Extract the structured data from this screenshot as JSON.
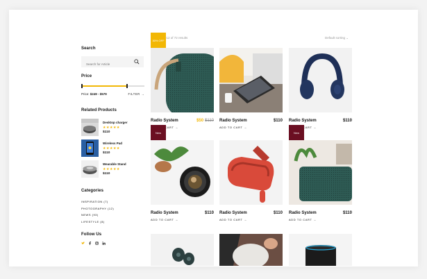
{
  "sidebar": {
    "search_title": "Search",
    "search_placeholder": "Search for Article",
    "price_title": "Price",
    "price_label": "Price:",
    "price_range": "$249 - $579",
    "price_fraction": 0.72,
    "filter_label": "FILTER",
    "related_title": "Related Products",
    "related": [
      {
        "name": "Desktop charger",
        "stars": "★★★★★",
        "price": "$110"
      },
      {
        "name": "Wireless Pad",
        "stars": "★★★★★",
        "price": "$110"
      },
      {
        "name": "Wearable Stand",
        "stars": "★★★★★",
        "price": "$110"
      }
    ],
    "categories_title": "Categories",
    "categories": [
      "INSPIRATION (7)",
      "PHOTOGRAPHY (12)",
      "NEWS (93)",
      "LIFESTYLE (8)"
    ],
    "follow_title": "Follow Us",
    "social_icons": [
      "twitter-icon",
      "facebook-icon",
      "instagram-icon",
      "linkedin-icon"
    ]
  },
  "main": {
    "results": "Showing 1-12 of 72 results",
    "sorting": "Default sorting",
    "products": [
      {
        "name": "Radio System",
        "price": "$50",
        "old_price": "$110",
        "badge": "30% OFF",
        "add": "ADD TO CART"
      },
      {
        "name": "Radio System",
        "price": "$110",
        "add": "ADD TO CART"
      },
      {
        "name": "Radio System",
        "price": "$110",
        "add": "ADD TO CART"
      },
      {
        "name": "Radio System",
        "price": "$110",
        "badge": "New",
        "add": "ADD TO CART"
      },
      {
        "name": "Radio System",
        "price": "$110",
        "add": "ADD TO CART"
      },
      {
        "name": "Radio System",
        "price": "$110",
        "badge": "New",
        "add": "ADD TO CART"
      }
    ]
  },
  "colors": {
    "accent": "#f2b705",
    "new_badge": "#6b0f22"
  }
}
